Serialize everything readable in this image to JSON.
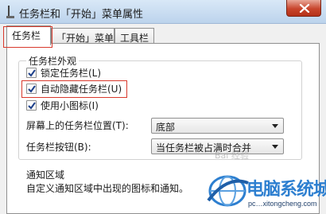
{
  "window": {
    "title": "任务栏和「开始」菜单属性",
    "icon": "taskbar-properties-icon",
    "close_icon": "close-icon"
  },
  "tabs": [
    {
      "label": "任务栏",
      "active": true
    },
    {
      "label": "「开始」菜单",
      "active": false
    },
    {
      "label": "工具栏",
      "active": false
    }
  ],
  "appearance": {
    "title": "任务栏外观",
    "lock_taskbar": {
      "label": "锁定任务栏(L)",
      "checked": true
    },
    "auto_hide": {
      "label": "自动隐藏任务栏(U)",
      "checked": true
    },
    "small_icons": {
      "label": "使用小图标(I)",
      "checked": true
    },
    "location": {
      "label": "屏幕上的任务栏位置(T):",
      "value": "底部"
    },
    "buttons": {
      "label": "任务栏按钮(B):",
      "value": "当任务栏被占满时合并"
    }
  },
  "notification": {
    "title": "通知区域",
    "description": "自定义通知区域中出现的图标和通知。"
  },
  "watermark": {
    "text": "电脑系统城",
    "url": "pc…xitongcheng.com",
    "ghost": "Bai 经验"
  },
  "colors": {
    "highlight_box": "#d9392c",
    "watermark_blue": "#2d7fd0",
    "close_red": "#c8452c"
  }
}
